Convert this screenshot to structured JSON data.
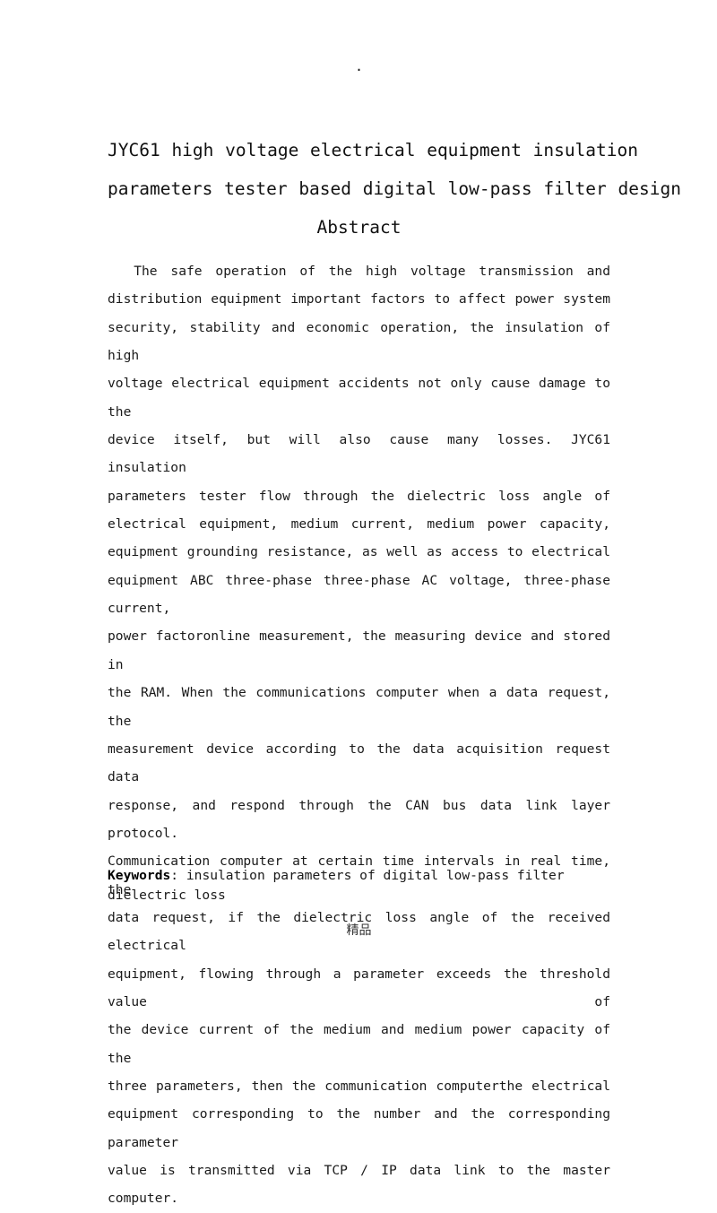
{
  "page": {
    "header_mark": ".",
    "footer_text": "精品",
    "background_color": "#ffffff",
    "text_color": "#1a1a1a"
  },
  "title": {
    "line1": "JYC61 high voltage electrical equipment insulation",
    "line2": "parameters tester based digital low-pass filter design"
  },
  "abstract": {
    "heading": "Abstract",
    "lines": [
      "The safe operation of the high voltage transmission and",
      "distribution equipment important factors to affect power system",
      "security, stability and economic operation, the insulation of high",
      "voltage electrical equipment accidents not only cause damage to the",
      "device itself, but will also cause many losses. JYC61 insulation",
      "parameters tester flow through the dielectric loss angle of",
      "electrical equipment, medium current, medium power capacity,",
      "equipment grounding resistance, as well as access to electrical",
      "equipment ABC three-phase three-phase AC voltage, three-phase current,",
      "power factoronline measurement, the measuring device and stored in",
      "the RAM. When the communications computer when a data request, the",
      "measurement device according to the data acquisition request data",
      "response, and respond through the CAN bus data link layer protocol.",
      "Communication computer at certain time intervals in real time, the",
      "data request, if the dielectric loss angle of the received electrical",
      "equipment, flowing through a parameter exceeds the threshold value of",
      "the device current of the medium and medium power capacity of the",
      "three parameters, then the communication computerthe electrical",
      "equipment corresponding to the number and the corresponding parameter",
      "value is transmitted via TCP / IP data link to the master computer."
    ]
  },
  "keywords": {
    "label": "Keywords",
    "separator": ": ",
    "value": "insulation parameters of digital low-pass filter dielectric loss"
  }
}
